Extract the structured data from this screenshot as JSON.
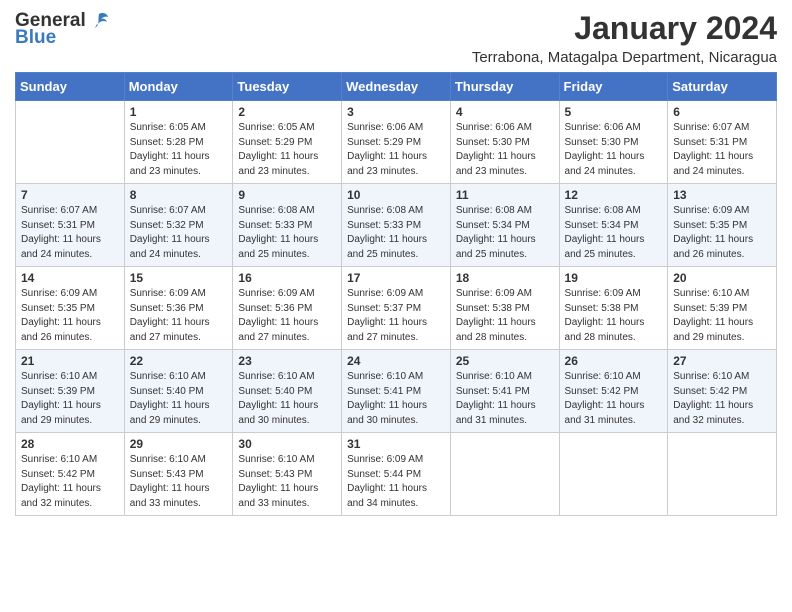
{
  "logo": {
    "general": "General",
    "blue": "Blue"
  },
  "title": "January 2024",
  "location": "Terrabona, Matagalpa Department, Nicaragua",
  "days_of_week": [
    "Sunday",
    "Monday",
    "Tuesday",
    "Wednesday",
    "Thursday",
    "Friday",
    "Saturday"
  ],
  "weeks": [
    [
      {
        "day": "",
        "sunrise": "",
        "sunset": "",
        "daylight": ""
      },
      {
        "day": "1",
        "sunrise": "Sunrise: 6:05 AM",
        "sunset": "Sunset: 5:28 PM",
        "daylight": "Daylight: 11 hours and 23 minutes."
      },
      {
        "day": "2",
        "sunrise": "Sunrise: 6:05 AM",
        "sunset": "Sunset: 5:29 PM",
        "daylight": "Daylight: 11 hours and 23 minutes."
      },
      {
        "day": "3",
        "sunrise": "Sunrise: 6:06 AM",
        "sunset": "Sunset: 5:29 PM",
        "daylight": "Daylight: 11 hours and 23 minutes."
      },
      {
        "day": "4",
        "sunrise": "Sunrise: 6:06 AM",
        "sunset": "Sunset: 5:30 PM",
        "daylight": "Daylight: 11 hours and 23 minutes."
      },
      {
        "day": "5",
        "sunrise": "Sunrise: 6:06 AM",
        "sunset": "Sunset: 5:30 PM",
        "daylight": "Daylight: 11 hours and 24 minutes."
      },
      {
        "day": "6",
        "sunrise": "Sunrise: 6:07 AM",
        "sunset": "Sunset: 5:31 PM",
        "daylight": "Daylight: 11 hours and 24 minutes."
      }
    ],
    [
      {
        "day": "7",
        "sunrise": "Sunrise: 6:07 AM",
        "sunset": "Sunset: 5:31 PM",
        "daylight": "Daylight: 11 hours and 24 minutes."
      },
      {
        "day": "8",
        "sunrise": "Sunrise: 6:07 AM",
        "sunset": "Sunset: 5:32 PM",
        "daylight": "Daylight: 11 hours and 24 minutes."
      },
      {
        "day": "9",
        "sunrise": "Sunrise: 6:08 AM",
        "sunset": "Sunset: 5:33 PM",
        "daylight": "Daylight: 11 hours and 25 minutes."
      },
      {
        "day": "10",
        "sunrise": "Sunrise: 6:08 AM",
        "sunset": "Sunset: 5:33 PM",
        "daylight": "Daylight: 11 hours and 25 minutes."
      },
      {
        "day": "11",
        "sunrise": "Sunrise: 6:08 AM",
        "sunset": "Sunset: 5:34 PM",
        "daylight": "Daylight: 11 hours and 25 minutes."
      },
      {
        "day": "12",
        "sunrise": "Sunrise: 6:08 AM",
        "sunset": "Sunset: 5:34 PM",
        "daylight": "Daylight: 11 hours and 25 minutes."
      },
      {
        "day": "13",
        "sunrise": "Sunrise: 6:09 AM",
        "sunset": "Sunset: 5:35 PM",
        "daylight": "Daylight: 11 hours and 26 minutes."
      }
    ],
    [
      {
        "day": "14",
        "sunrise": "Sunrise: 6:09 AM",
        "sunset": "Sunset: 5:35 PM",
        "daylight": "Daylight: 11 hours and 26 minutes."
      },
      {
        "day": "15",
        "sunrise": "Sunrise: 6:09 AM",
        "sunset": "Sunset: 5:36 PM",
        "daylight": "Daylight: 11 hours and 27 minutes."
      },
      {
        "day": "16",
        "sunrise": "Sunrise: 6:09 AM",
        "sunset": "Sunset: 5:36 PM",
        "daylight": "Daylight: 11 hours and 27 minutes."
      },
      {
        "day": "17",
        "sunrise": "Sunrise: 6:09 AM",
        "sunset": "Sunset: 5:37 PM",
        "daylight": "Daylight: 11 hours and 27 minutes."
      },
      {
        "day": "18",
        "sunrise": "Sunrise: 6:09 AM",
        "sunset": "Sunset: 5:38 PM",
        "daylight": "Daylight: 11 hours and 28 minutes."
      },
      {
        "day": "19",
        "sunrise": "Sunrise: 6:09 AM",
        "sunset": "Sunset: 5:38 PM",
        "daylight": "Daylight: 11 hours and 28 minutes."
      },
      {
        "day": "20",
        "sunrise": "Sunrise: 6:10 AM",
        "sunset": "Sunset: 5:39 PM",
        "daylight": "Daylight: 11 hours and 29 minutes."
      }
    ],
    [
      {
        "day": "21",
        "sunrise": "Sunrise: 6:10 AM",
        "sunset": "Sunset: 5:39 PM",
        "daylight": "Daylight: 11 hours and 29 minutes."
      },
      {
        "day": "22",
        "sunrise": "Sunrise: 6:10 AM",
        "sunset": "Sunset: 5:40 PM",
        "daylight": "Daylight: 11 hours and 29 minutes."
      },
      {
        "day": "23",
        "sunrise": "Sunrise: 6:10 AM",
        "sunset": "Sunset: 5:40 PM",
        "daylight": "Daylight: 11 hours and 30 minutes."
      },
      {
        "day": "24",
        "sunrise": "Sunrise: 6:10 AM",
        "sunset": "Sunset: 5:41 PM",
        "daylight": "Daylight: 11 hours and 30 minutes."
      },
      {
        "day": "25",
        "sunrise": "Sunrise: 6:10 AM",
        "sunset": "Sunset: 5:41 PM",
        "daylight": "Daylight: 11 hours and 31 minutes."
      },
      {
        "day": "26",
        "sunrise": "Sunrise: 6:10 AM",
        "sunset": "Sunset: 5:42 PM",
        "daylight": "Daylight: 11 hours and 31 minutes."
      },
      {
        "day": "27",
        "sunrise": "Sunrise: 6:10 AM",
        "sunset": "Sunset: 5:42 PM",
        "daylight": "Daylight: 11 hours and 32 minutes."
      }
    ],
    [
      {
        "day": "28",
        "sunrise": "Sunrise: 6:10 AM",
        "sunset": "Sunset: 5:42 PM",
        "daylight": "Daylight: 11 hours and 32 minutes."
      },
      {
        "day": "29",
        "sunrise": "Sunrise: 6:10 AM",
        "sunset": "Sunset: 5:43 PM",
        "daylight": "Daylight: 11 hours and 33 minutes."
      },
      {
        "day": "30",
        "sunrise": "Sunrise: 6:10 AM",
        "sunset": "Sunset: 5:43 PM",
        "daylight": "Daylight: 11 hours and 33 minutes."
      },
      {
        "day": "31",
        "sunrise": "Sunrise: 6:09 AM",
        "sunset": "Sunset: 5:44 PM",
        "daylight": "Daylight: 11 hours and 34 minutes."
      },
      {
        "day": "",
        "sunrise": "",
        "sunset": "",
        "daylight": ""
      },
      {
        "day": "",
        "sunrise": "",
        "sunset": "",
        "daylight": ""
      },
      {
        "day": "",
        "sunrise": "",
        "sunset": "",
        "daylight": ""
      }
    ]
  ]
}
